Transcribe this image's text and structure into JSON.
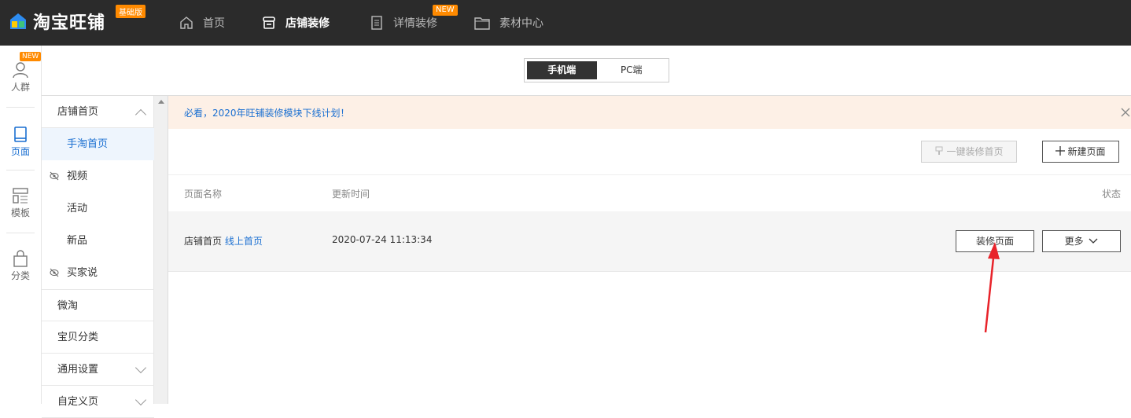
{
  "app": {
    "title": "淘宝旺铺",
    "edition_badge": "基础版"
  },
  "topnav": [
    {
      "label": "首页",
      "icon": "home-icon"
    },
    {
      "label": "店铺装修",
      "icon": "store-icon",
      "active": true
    },
    {
      "label": "详情装修",
      "icon": "document-icon",
      "badge": "NEW"
    },
    {
      "label": "素材中心",
      "icon": "folder-icon"
    }
  ],
  "rail": [
    {
      "label": "人群",
      "icon": "person-icon",
      "badge": "NEW"
    },
    {
      "label": "页面",
      "icon": "page-icon",
      "active": true
    },
    {
      "label": "模板",
      "icon": "template-icon"
    },
    {
      "label": "分类",
      "icon": "bag-icon"
    }
  ],
  "device_toggle": {
    "mobile": "手机端",
    "pc": "PC端",
    "selected": "mobile"
  },
  "sidebar": {
    "items": [
      {
        "label": "店铺首页"
      },
      {
        "label": "手淘首页"
      },
      {
        "label": "视频"
      },
      {
        "label": "活动"
      },
      {
        "label": "新品"
      },
      {
        "label": "买家说"
      },
      {
        "label": "微淘"
      },
      {
        "label": "宝贝分类"
      },
      {
        "label": "通用设置"
      },
      {
        "label": "自定义页"
      }
    ]
  },
  "notice": {
    "text": "必看，2020年旺铺装修模块下线计划！"
  },
  "toolbar": {
    "one_click_label": "一键装修首页",
    "new_page_label": "新建页面"
  },
  "table": {
    "headers": {
      "name": "页面名称",
      "updated": "更新时间",
      "status": "状态"
    },
    "rows": [
      {
        "name": "店铺首页",
        "tag": "线上首页",
        "updated": "2020-07-24 11:13:34",
        "decorate_label": "装修页面",
        "more_label": "更多"
      }
    ]
  },
  "colors": {
    "accent": "#1a6fd1",
    "badge": "#ff8a00",
    "topbar": "#2b2b2b",
    "annotation_arrow": "#e8232a"
  }
}
